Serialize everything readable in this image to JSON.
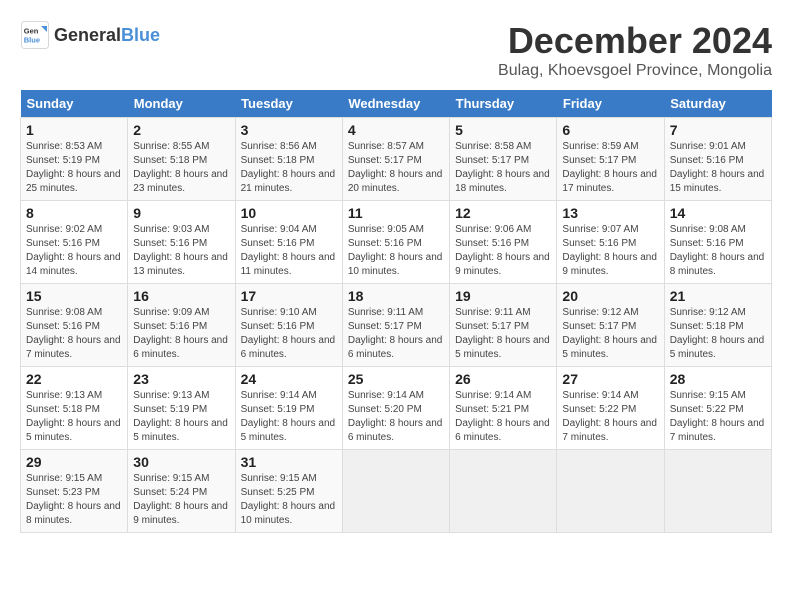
{
  "logo": {
    "text_general": "General",
    "text_blue": "Blue"
  },
  "title": "December 2024",
  "subtitle": "Bulag, Khoevsgoel Province, Mongolia",
  "days_of_week": [
    "Sunday",
    "Monday",
    "Tuesday",
    "Wednesday",
    "Thursday",
    "Friday",
    "Saturday"
  ],
  "weeks": [
    [
      {
        "day": "1",
        "sunrise": "Sunrise: 8:53 AM",
        "sunset": "Sunset: 5:19 PM",
        "daylight": "Daylight: 8 hours and 25 minutes."
      },
      {
        "day": "2",
        "sunrise": "Sunrise: 8:55 AM",
        "sunset": "Sunset: 5:18 PM",
        "daylight": "Daylight: 8 hours and 23 minutes."
      },
      {
        "day": "3",
        "sunrise": "Sunrise: 8:56 AM",
        "sunset": "Sunset: 5:18 PM",
        "daylight": "Daylight: 8 hours and 21 minutes."
      },
      {
        "day": "4",
        "sunrise": "Sunrise: 8:57 AM",
        "sunset": "Sunset: 5:17 PM",
        "daylight": "Daylight: 8 hours and 20 minutes."
      },
      {
        "day": "5",
        "sunrise": "Sunrise: 8:58 AM",
        "sunset": "Sunset: 5:17 PM",
        "daylight": "Daylight: 8 hours and 18 minutes."
      },
      {
        "day": "6",
        "sunrise": "Sunrise: 8:59 AM",
        "sunset": "Sunset: 5:17 PM",
        "daylight": "Daylight: 8 hours and 17 minutes."
      },
      {
        "day": "7",
        "sunrise": "Sunrise: 9:01 AM",
        "sunset": "Sunset: 5:16 PM",
        "daylight": "Daylight: 8 hours and 15 minutes."
      }
    ],
    [
      {
        "day": "8",
        "sunrise": "Sunrise: 9:02 AM",
        "sunset": "Sunset: 5:16 PM",
        "daylight": "Daylight: 8 hours and 14 minutes."
      },
      {
        "day": "9",
        "sunrise": "Sunrise: 9:03 AM",
        "sunset": "Sunset: 5:16 PM",
        "daylight": "Daylight: 8 hours and 13 minutes."
      },
      {
        "day": "10",
        "sunrise": "Sunrise: 9:04 AM",
        "sunset": "Sunset: 5:16 PM",
        "daylight": "Daylight: 8 hours and 11 minutes."
      },
      {
        "day": "11",
        "sunrise": "Sunrise: 9:05 AM",
        "sunset": "Sunset: 5:16 PM",
        "daylight": "Daylight: 8 hours and 10 minutes."
      },
      {
        "day": "12",
        "sunrise": "Sunrise: 9:06 AM",
        "sunset": "Sunset: 5:16 PM",
        "daylight": "Daylight: 8 hours and 9 minutes."
      },
      {
        "day": "13",
        "sunrise": "Sunrise: 9:07 AM",
        "sunset": "Sunset: 5:16 PM",
        "daylight": "Daylight: 8 hours and 9 minutes."
      },
      {
        "day": "14",
        "sunrise": "Sunrise: 9:08 AM",
        "sunset": "Sunset: 5:16 PM",
        "daylight": "Daylight: 8 hours and 8 minutes."
      }
    ],
    [
      {
        "day": "15",
        "sunrise": "Sunrise: 9:08 AM",
        "sunset": "Sunset: 5:16 PM",
        "daylight": "Daylight: 8 hours and 7 minutes."
      },
      {
        "day": "16",
        "sunrise": "Sunrise: 9:09 AM",
        "sunset": "Sunset: 5:16 PM",
        "daylight": "Daylight: 8 hours and 6 minutes."
      },
      {
        "day": "17",
        "sunrise": "Sunrise: 9:10 AM",
        "sunset": "Sunset: 5:16 PM",
        "daylight": "Daylight: 8 hours and 6 minutes."
      },
      {
        "day": "18",
        "sunrise": "Sunrise: 9:11 AM",
        "sunset": "Sunset: 5:17 PM",
        "daylight": "Daylight: 8 hours and 6 minutes."
      },
      {
        "day": "19",
        "sunrise": "Sunrise: 9:11 AM",
        "sunset": "Sunset: 5:17 PM",
        "daylight": "Daylight: 8 hours and 5 minutes."
      },
      {
        "day": "20",
        "sunrise": "Sunrise: 9:12 AM",
        "sunset": "Sunset: 5:17 PM",
        "daylight": "Daylight: 8 hours and 5 minutes."
      },
      {
        "day": "21",
        "sunrise": "Sunrise: 9:12 AM",
        "sunset": "Sunset: 5:18 PM",
        "daylight": "Daylight: 8 hours and 5 minutes."
      }
    ],
    [
      {
        "day": "22",
        "sunrise": "Sunrise: 9:13 AM",
        "sunset": "Sunset: 5:18 PM",
        "daylight": "Daylight: 8 hours and 5 minutes."
      },
      {
        "day": "23",
        "sunrise": "Sunrise: 9:13 AM",
        "sunset": "Sunset: 5:19 PM",
        "daylight": "Daylight: 8 hours and 5 minutes."
      },
      {
        "day": "24",
        "sunrise": "Sunrise: 9:14 AM",
        "sunset": "Sunset: 5:19 PM",
        "daylight": "Daylight: 8 hours and 5 minutes."
      },
      {
        "day": "25",
        "sunrise": "Sunrise: 9:14 AM",
        "sunset": "Sunset: 5:20 PM",
        "daylight": "Daylight: 8 hours and 6 minutes."
      },
      {
        "day": "26",
        "sunrise": "Sunrise: 9:14 AM",
        "sunset": "Sunset: 5:21 PM",
        "daylight": "Daylight: 8 hours and 6 minutes."
      },
      {
        "day": "27",
        "sunrise": "Sunrise: 9:14 AM",
        "sunset": "Sunset: 5:22 PM",
        "daylight": "Daylight: 8 hours and 7 minutes."
      },
      {
        "day": "28",
        "sunrise": "Sunrise: 9:15 AM",
        "sunset": "Sunset: 5:22 PM",
        "daylight": "Daylight: 8 hours and 7 minutes."
      }
    ],
    [
      {
        "day": "29",
        "sunrise": "Sunrise: 9:15 AM",
        "sunset": "Sunset: 5:23 PM",
        "daylight": "Daylight: 8 hours and 8 minutes."
      },
      {
        "day": "30",
        "sunrise": "Sunrise: 9:15 AM",
        "sunset": "Sunset: 5:24 PM",
        "daylight": "Daylight: 8 hours and 9 minutes."
      },
      {
        "day": "31",
        "sunrise": "Sunrise: 9:15 AM",
        "sunset": "Sunset: 5:25 PM",
        "daylight": "Daylight: 8 hours and 10 minutes."
      },
      null,
      null,
      null,
      null
    ]
  ]
}
